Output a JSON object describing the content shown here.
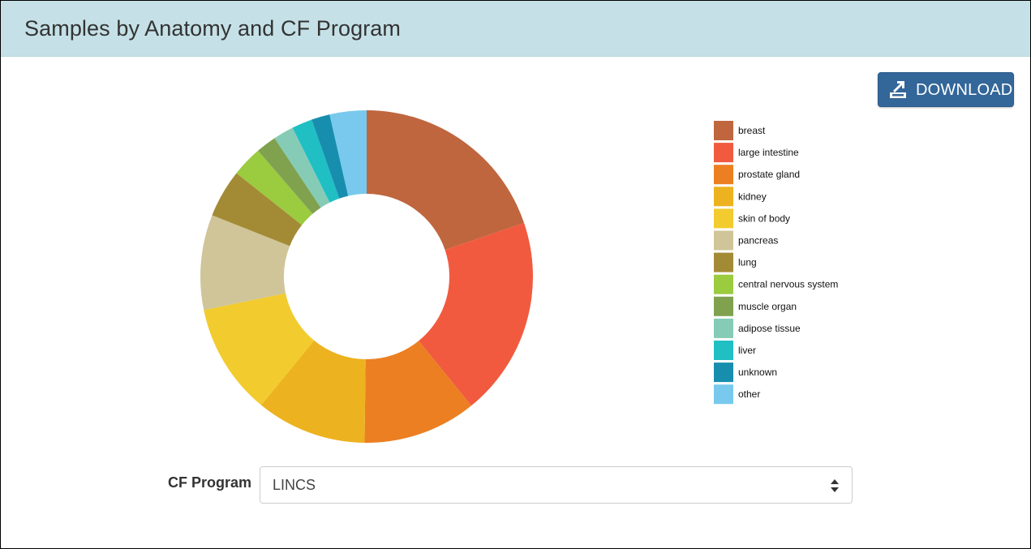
{
  "header": {
    "title": "Samples by Anatomy and CF Program"
  },
  "toolbar": {
    "download_label": "DOWNLOAD",
    "download_icon": "download-icon"
  },
  "filter": {
    "label": "CF Program",
    "selected": "LINCS",
    "caret_icon": "sort-caret-icon"
  },
  "chart_data": {
    "type": "pie",
    "subtype": "donut",
    "legend_position": "right",
    "labels": [
      "breast",
      "large intestine",
      "prostate gland",
      "kidney",
      "skin of body",
      "pancreas",
      "lung",
      "central nervous system",
      "muscle organ",
      "adipose tissue",
      "liver",
      "unknown",
      "other"
    ],
    "values": [
      19.9,
      19.5,
      11.1,
      10.8,
      10.9,
      9.3,
      4.7,
      3.0,
      2.0,
      2.0,
      2.0,
      1.8,
      3.6
    ],
    "colors": [
      "#c0663e",
      "#f15a3f",
      "#ec7f22",
      "#edb21f",
      "#f2cb2e",
      "#d0c599",
      "#a38b36",
      "#9bcb3f",
      "#80a24f",
      "#86cbb6",
      "#1fbfc4",
      "#188eae",
      "#78c9ed"
    ]
  }
}
